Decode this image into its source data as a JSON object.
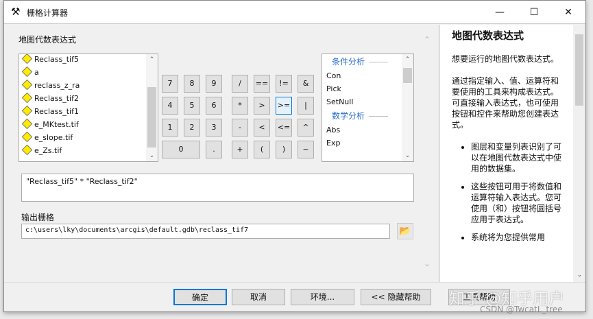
{
  "window": {
    "title": "栅格计算器",
    "minimize": "—",
    "maximize": "☐",
    "close": "✕"
  },
  "expr_label": "地图代数表达式",
  "layers": [
    "Reclass_tif5",
    "a",
    "reclass_z_ra",
    "Reclass_tif2",
    "Reclass_tif1",
    "e_MKtest.tif",
    "e_slope.tif",
    "e_Zs.tif"
  ],
  "keypad": {
    "numbers": [
      "7",
      "8",
      "9",
      "4",
      "5",
      "6",
      "1",
      "2",
      "3",
      "0",
      "."
    ],
    "operators": [
      "/",
      "==",
      "!=",
      "&",
      "*",
      ">",
      ">=",
      "|",
      "-",
      "<",
      "<=",
      "^",
      "+",
      "(",
      ")",
      "~"
    ]
  },
  "functions": {
    "cat1": "条件分析",
    "items1": [
      "Con",
      "Pick",
      "SetNull"
    ],
    "cat2": "数学分析",
    "items2": [
      "Abs",
      "Exp"
    ]
  },
  "expression": "\"Reclass_tif5\" * \"Reclass_tif2\"",
  "output_label": "输出栅格",
  "output_value": "c:\\users\\lky\\documents\\arcgis\\default.gdb\\reclass_tif7",
  "help": {
    "title": "地图代数表达式",
    "p1": "想要运行的地图代数表达式。",
    "p2": "通过指定输入、值、运算符和要使用的工具来构成表达式。可直接输入表达式，也可使用按钮和控件来帮助您创建表达式。",
    "bullets": [
      "图层和变量列表识别了可以在地图代数表达式中使用的数据集。",
      "这些按钮可用于将数值和运算符输入表达式。您可使用（和）按钮将圆括号应用于表达式。",
      "系统将为您提供常用"
    ]
  },
  "buttons": {
    "ok": "确定",
    "cancel": "取消",
    "env": "环境...",
    "hide_help": "<< 隐藏帮助",
    "tool_help": "工具帮助"
  },
  "watermark": "知乎 @知乎用户",
  "watermark2": "CSDN @TwcatL_tree"
}
